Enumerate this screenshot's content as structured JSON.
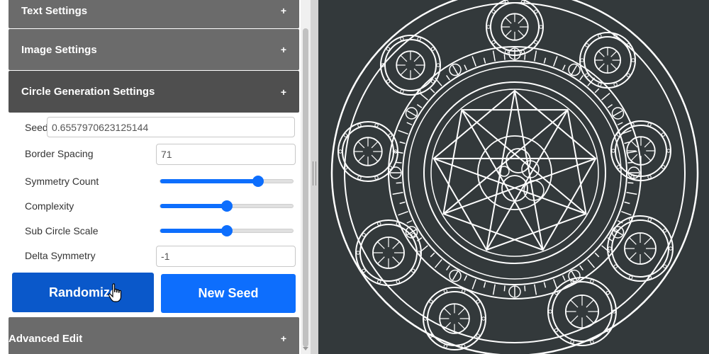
{
  "panel": {
    "sections": {
      "text": {
        "label": "Text Settings",
        "toggle": "+"
      },
      "image": {
        "label": "Image Settings",
        "toggle": "+"
      },
      "circle": {
        "label": "Circle Generation Settings",
        "toggle": "+"
      },
      "advanced": {
        "label": "Advanced Edit",
        "toggle": "+"
      }
    },
    "fields": {
      "seed": {
        "label": "Seed",
        "value": "0.6557970623125144"
      },
      "border_spacing": {
        "label": "Border Spacing",
        "value": "71"
      },
      "symmetry_count": {
        "label": "Symmetry Count",
        "level": 0.74
      },
      "complexity": {
        "label": "Complexity",
        "level": 0.5
      },
      "sub_circle_scale": {
        "label": "Sub Circle Scale",
        "level": 0.5
      },
      "delta_symmetry": {
        "label": "Delta Symmetry",
        "value": "-1"
      }
    },
    "buttons": {
      "randomize": "Randomize",
      "new_seed": "New Seed"
    }
  },
  "colors": {
    "accent": "#0d6efd",
    "header_bg": "#6b6b6b",
    "header_active_bg": "#4f4f4f",
    "canvas_bg": "#33393b",
    "canvas_stroke": "#ffffff"
  },
  "icons": {
    "cursor": "hand-pointer-icon",
    "canvas": "magic-circle"
  }
}
